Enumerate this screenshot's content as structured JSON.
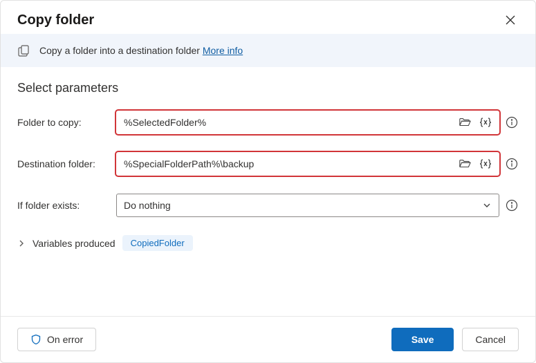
{
  "dialog": {
    "title": "Copy folder",
    "banner_text": "Copy a folder into a destination folder",
    "more_info": "More info"
  },
  "section": {
    "title": "Select parameters"
  },
  "fields": {
    "folder_to_copy": {
      "label": "Folder to copy:",
      "value": "%SelectedFolder%"
    },
    "destination": {
      "label": "Destination folder:",
      "value": "%SpecialFolderPath%\\backup"
    },
    "if_exists": {
      "label": "If folder exists:",
      "value": "Do nothing"
    }
  },
  "variables": {
    "label": "Variables produced",
    "items": [
      "CopiedFolder"
    ]
  },
  "footer": {
    "on_error": "On error",
    "save": "Save",
    "cancel": "Cancel"
  }
}
